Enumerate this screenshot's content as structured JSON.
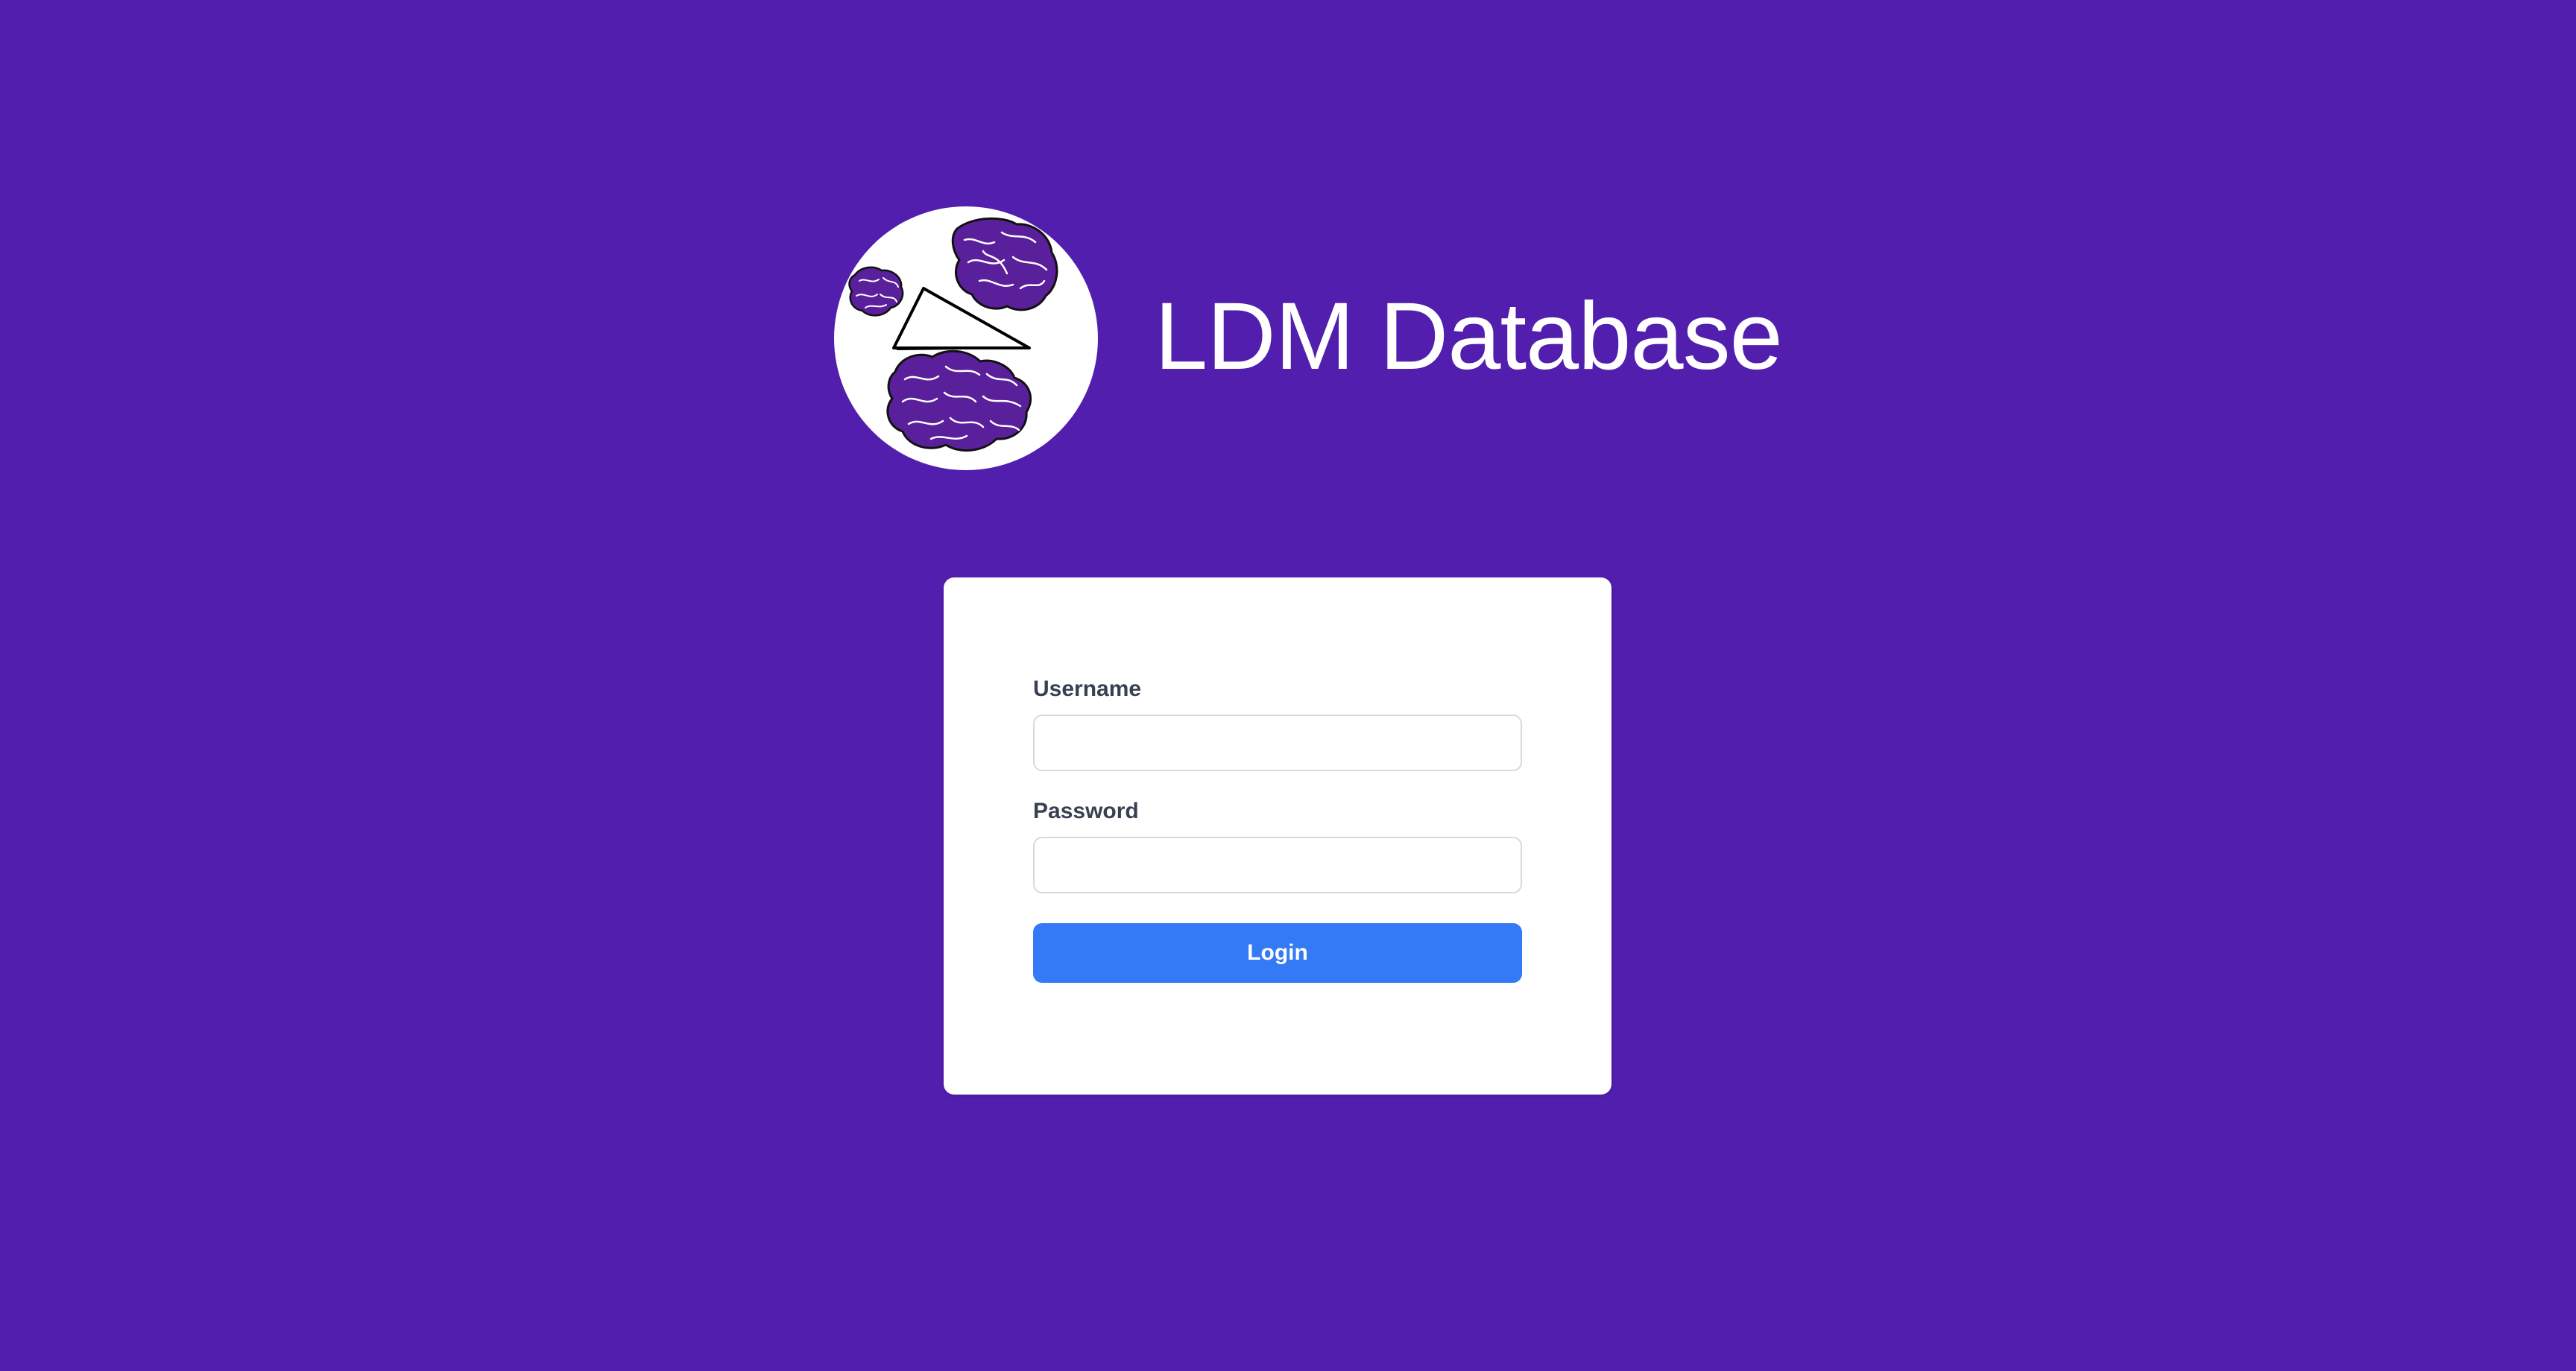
{
  "app": {
    "title": "LDM Database"
  },
  "colors": {
    "background": "#521eae",
    "card": "#ffffff",
    "button": "#3479f5",
    "brain": "#5a1f9a"
  },
  "logo": {
    "icon": "brain-triangle-logo"
  },
  "login_form": {
    "username_label": "Username",
    "username_value": "",
    "password_label": "Password",
    "password_value": "",
    "login_label": "Login"
  }
}
